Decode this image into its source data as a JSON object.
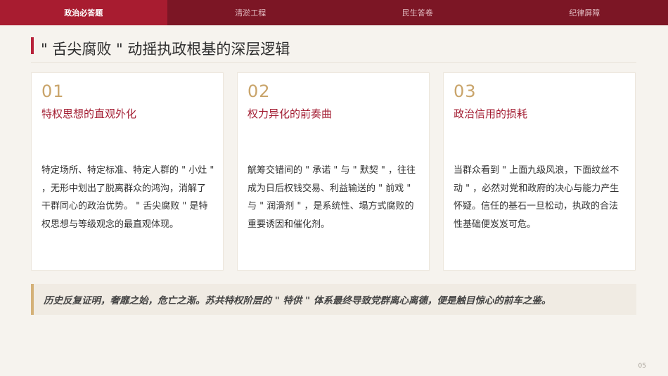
{
  "tabs": [
    {
      "label": "政治必答题",
      "active": true
    },
    {
      "label": "清淤工程",
      "active": false
    },
    {
      "label": "民生答卷",
      "active": false
    },
    {
      "label": "纪律屏障",
      "active": false
    }
  ],
  "page_title": "\" 舌尖腐败 \" 动摇执政根基的深层逻辑",
  "cards": [
    {
      "number": "01",
      "heading": "特权思想的直观外化",
      "body": "特定场所、特定标准、特定人群的 \" 小灶 \" ，无形中划出了脱离群众的鸿沟，消解了干群同心的政治优势。 \" 舌尖腐败 \" 是特权思想与等级观念的最直观体现。"
    },
    {
      "number": "02",
      "heading": "权力异化的前奏曲",
      "body": "觥筹交错间的 \" 承诺 \" 与 \" 默契 \" ，往往成为日后权钱交易、利益输送的 \" 前戏 \" 与 \" 润滑剂 \" ，是系统性、塌方式腐败的重要诱因和催化剂。"
    },
    {
      "number": "03",
      "heading": "政治信用的损耗",
      "body": "当群众看到 \" 上面九级风浪，下面纹丝不动 \" ，必然对党和政府的决心与能力产生怀疑。信任的基石一旦松动，执政的合法性基础便岌岌可危。"
    }
  ],
  "quote": "历史反复证明，奢靡之始，危亡之渐。苏共特权阶层的 \" 特供 \" 体系最终导致党群离心离德，便是触目惊心的前车之鉴。",
  "page_number": "05",
  "colors": {
    "tab_bar": "#7c1625",
    "tab_active": "#a81c30",
    "accent_red": "#a31d32",
    "accent_gold": "#c9a46a",
    "background": "#f6f3ee"
  }
}
